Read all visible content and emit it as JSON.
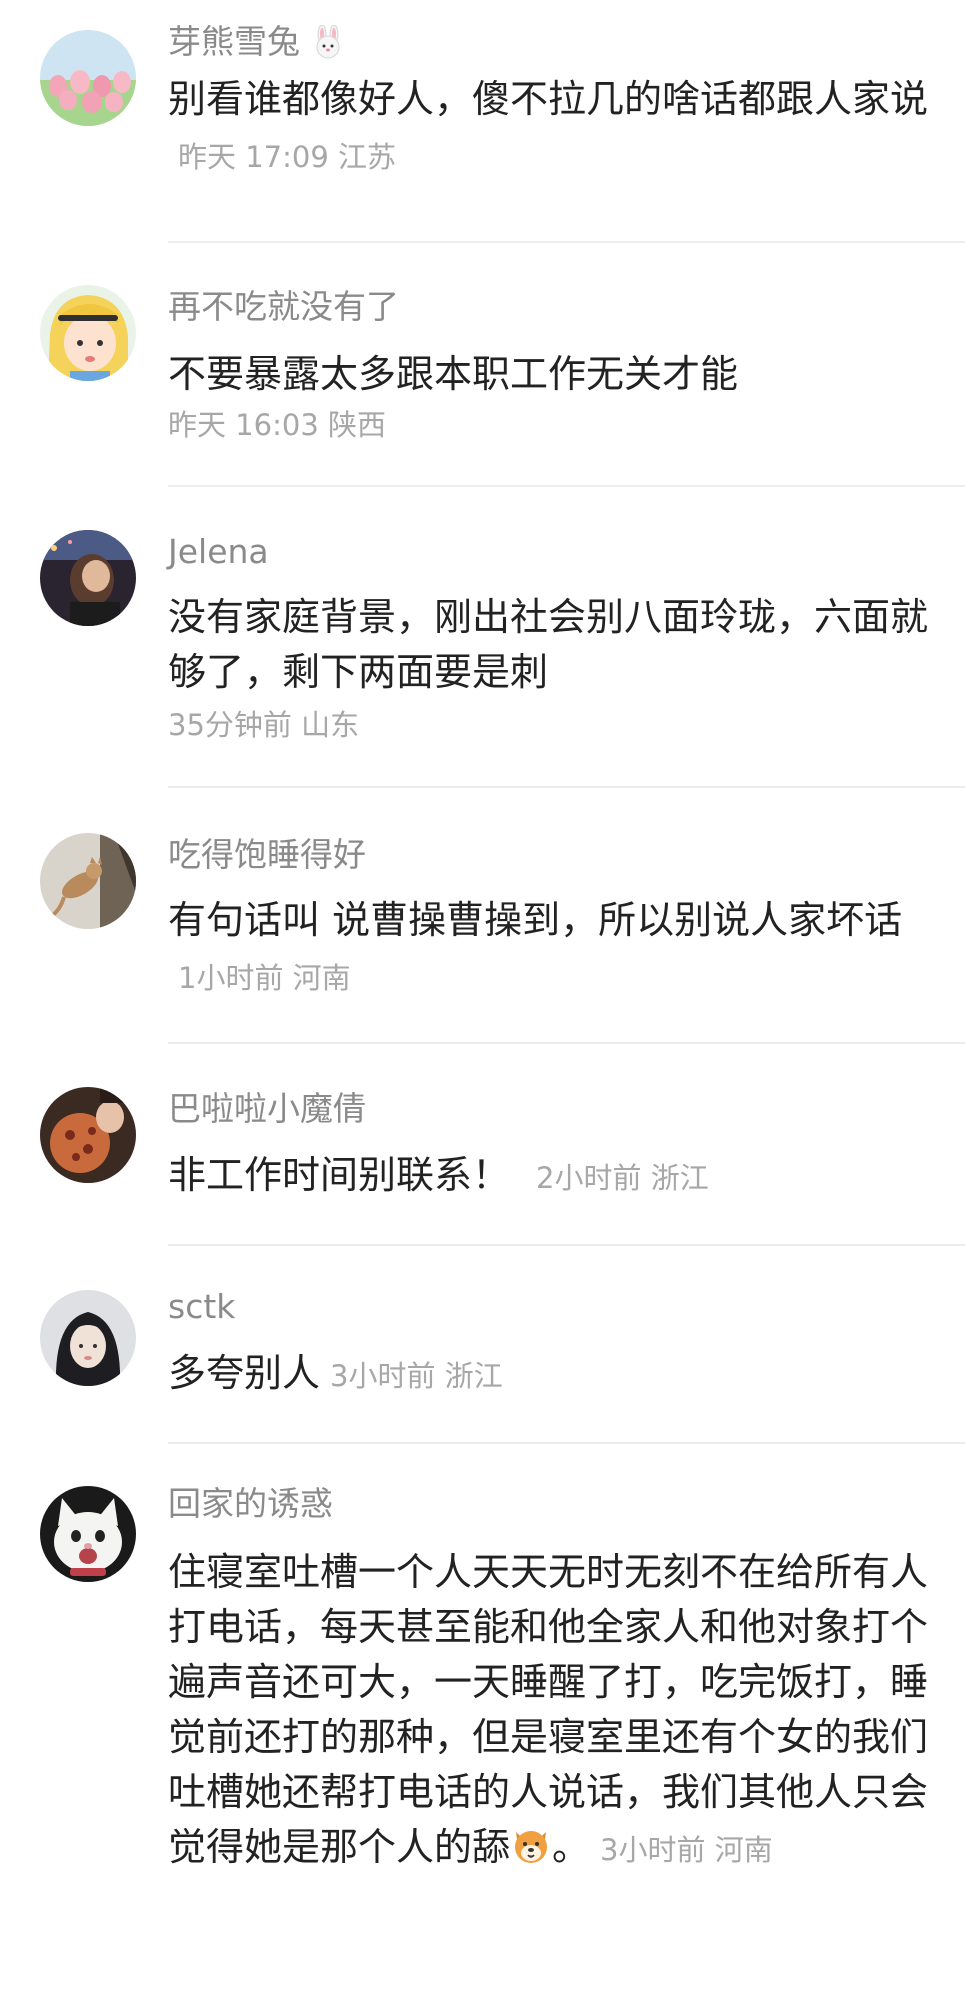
{
  "comments": [
    {
      "username": "芽熊雪兔",
      "username_emoji": "rabbit-face-icon",
      "text": "别看谁都像好人，傻不拉几的啥话都跟人家说",
      "time": "昨天 17:09",
      "location": "江苏",
      "avatar": "tulip-field-icon"
    },
    {
      "username": "再不吃就没有了",
      "text": "不要暴露太多跟本职工作无关才能",
      "time": "昨天 16:03",
      "location": "陕西",
      "avatar": "cartoon-girl-icon"
    },
    {
      "username": "Jelena",
      "text": "没有家庭背景，刚出社会别八面玲珑，六面就够了，剩下两面要是刺",
      "time": "35分钟前",
      "location": "山东",
      "avatar": "portrait-photo-icon"
    },
    {
      "username": "吃得饱睡得好",
      "text": "有句话叫 说曹操曹操到，所以别说人家坏话",
      "time": "1小时前",
      "location": "河南",
      "avatar": "cat-photo-icon"
    },
    {
      "username": "巴啦啦小魔倩",
      "text": "非工作时间别联系！",
      "time": "2小时前",
      "location": "浙江",
      "avatar": "food-photo-icon"
    },
    {
      "username": "sctk",
      "text": "多夸别人",
      "time": "3小时前",
      "location": "浙江",
      "avatar": "girl-portrait-icon"
    },
    {
      "username": "回家的诱惑",
      "text": "住寝室吐槽一个人天天无时无刻不在给所有人打电话，每天甚至能和他全家人和他对象打个遍声音还可大，一天睡醒了打，吃完饭打，睡觉前还打的那种，但是寝室里还有个女的我们吐槽她还帮打电话的人说话，我们其他人只会觉得她是那个人的舔",
      "text_tail": "。",
      "text_emoji": "dog-face-icon",
      "time": "3小时前",
      "location": "河南",
      "avatar": "white-cat-icon"
    }
  ]
}
